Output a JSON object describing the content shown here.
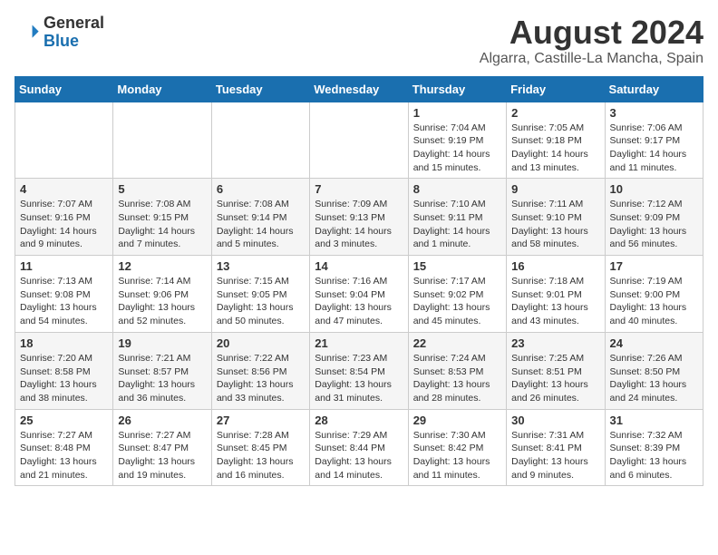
{
  "header": {
    "logo_general": "General",
    "logo_blue": "Blue",
    "month_year": "August 2024",
    "location": "Algarra, Castille-La Mancha, Spain"
  },
  "weekdays": [
    "Sunday",
    "Monday",
    "Tuesday",
    "Wednesday",
    "Thursday",
    "Friday",
    "Saturday"
  ],
  "weeks": [
    [
      {
        "day": "",
        "info": ""
      },
      {
        "day": "",
        "info": ""
      },
      {
        "day": "",
        "info": ""
      },
      {
        "day": "",
        "info": ""
      },
      {
        "day": "1",
        "info": "Sunrise: 7:04 AM\nSunset: 9:19 PM\nDaylight: 14 hours\nand 15 minutes."
      },
      {
        "day": "2",
        "info": "Sunrise: 7:05 AM\nSunset: 9:18 PM\nDaylight: 14 hours\nand 13 minutes."
      },
      {
        "day": "3",
        "info": "Sunrise: 7:06 AM\nSunset: 9:17 PM\nDaylight: 14 hours\nand 11 minutes."
      }
    ],
    [
      {
        "day": "4",
        "info": "Sunrise: 7:07 AM\nSunset: 9:16 PM\nDaylight: 14 hours\nand 9 minutes."
      },
      {
        "day": "5",
        "info": "Sunrise: 7:08 AM\nSunset: 9:15 PM\nDaylight: 14 hours\nand 7 minutes."
      },
      {
        "day": "6",
        "info": "Sunrise: 7:08 AM\nSunset: 9:14 PM\nDaylight: 14 hours\nand 5 minutes."
      },
      {
        "day": "7",
        "info": "Sunrise: 7:09 AM\nSunset: 9:13 PM\nDaylight: 14 hours\nand 3 minutes."
      },
      {
        "day": "8",
        "info": "Sunrise: 7:10 AM\nSunset: 9:11 PM\nDaylight: 14 hours\nand 1 minute."
      },
      {
        "day": "9",
        "info": "Sunrise: 7:11 AM\nSunset: 9:10 PM\nDaylight: 13 hours\nand 58 minutes."
      },
      {
        "day": "10",
        "info": "Sunrise: 7:12 AM\nSunset: 9:09 PM\nDaylight: 13 hours\nand 56 minutes."
      }
    ],
    [
      {
        "day": "11",
        "info": "Sunrise: 7:13 AM\nSunset: 9:08 PM\nDaylight: 13 hours\nand 54 minutes."
      },
      {
        "day": "12",
        "info": "Sunrise: 7:14 AM\nSunset: 9:06 PM\nDaylight: 13 hours\nand 52 minutes."
      },
      {
        "day": "13",
        "info": "Sunrise: 7:15 AM\nSunset: 9:05 PM\nDaylight: 13 hours\nand 50 minutes."
      },
      {
        "day": "14",
        "info": "Sunrise: 7:16 AM\nSunset: 9:04 PM\nDaylight: 13 hours\nand 47 minutes."
      },
      {
        "day": "15",
        "info": "Sunrise: 7:17 AM\nSunset: 9:02 PM\nDaylight: 13 hours\nand 45 minutes."
      },
      {
        "day": "16",
        "info": "Sunrise: 7:18 AM\nSunset: 9:01 PM\nDaylight: 13 hours\nand 43 minutes."
      },
      {
        "day": "17",
        "info": "Sunrise: 7:19 AM\nSunset: 9:00 PM\nDaylight: 13 hours\nand 40 minutes."
      }
    ],
    [
      {
        "day": "18",
        "info": "Sunrise: 7:20 AM\nSunset: 8:58 PM\nDaylight: 13 hours\nand 38 minutes."
      },
      {
        "day": "19",
        "info": "Sunrise: 7:21 AM\nSunset: 8:57 PM\nDaylight: 13 hours\nand 36 minutes."
      },
      {
        "day": "20",
        "info": "Sunrise: 7:22 AM\nSunset: 8:56 PM\nDaylight: 13 hours\nand 33 minutes."
      },
      {
        "day": "21",
        "info": "Sunrise: 7:23 AM\nSunset: 8:54 PM\nDaylight: 13 hours\nand 31 minutes."
      },
      {
        "day": "22",
        "info": "Sunrise: 7:24 AM\nSunset: 8:53 PM\nDaylight: 13 hours\nand 28 minutes."
      },
      {
        "day": "23",
        "info": "Sunrise: 7:25 AM\nSunset: 8:51 PM\nDaylight: 13 hours\nand 26 minutes."
      },
      {
        "day": "24",
        "info": "Sunrise: 7:26 AM\nSunset: 8:50 PM\nDaylight: 13 hours\nand 24 minutes."
      }
    ],
    [
      {
        "day": "25",
        "info": "Sunrise: 7:27 AM\nSunset: 8:48 PM\nDaylight: 13 hours\nand 21 minutes."
      },
      {
        "day": "26",
        "info": "Sunrise: 7:27 AM\nSunset: 8:47 PM\nDaylight: 13 hours\nand 19 minutes."
      },
      {
        "day": "27",
        "info": "Sunrise: 7:28 AM\nSunset: 8:45 PM\nDaylight: 13 hours\nand 16 minutes."
      },
      {
        "day": "28",
        "info": "Sunrise: 7:29 AM\nSunset: 8:44 PM\nDaylight: 13 hours\nand 14 minutes."
      },
      {
        "day": "29",
        "info": "Sunrise: 7:30 AM\nSunset: 8:42 PM\nDaylight: 13 hours\nand 11 minutes."
      },
      {
        "day": "30",
        "info": "Sunrise: 7:31 AM\nSunset: 8:41 PM\nDaylight: 13 hours\nand 9 minutes."
      },
      {
        "day": "31",
        "info": "Sunrise: 7:32 AM\nSunset: 8:39 PM\nDaylight: 13 hours\nand 6 minutes."
      }
    ]
  ]
}
